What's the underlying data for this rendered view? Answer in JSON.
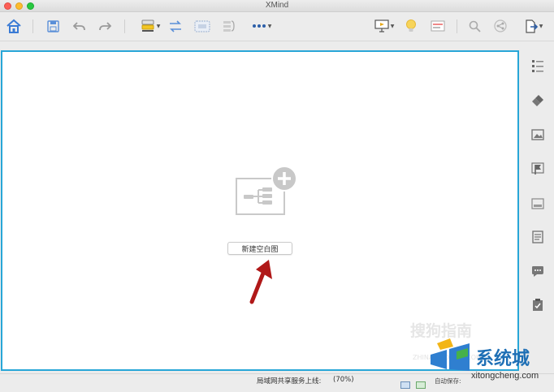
{
  "window": {
    "title": "XMind"
  },
  "toolbar": {
    "icons": [
      "home-icon",
      "save-icon",
      "undo-icon",
      "redo-icon",
      "style-icon",
      "relationship-icon",
      "boundary-icon",
      "summary-icon",
      "more-icon",
      "presentation-icon",
      "idea-icon",
      "outline-icon",
      "search-icon",
      "share-icon",
      "export-icon"
    ]
  },
  "canvas": {
    "new_blank_label": "新建空白图"
  },
  "statusbar": {
    "share_label": "局域网共享服务上线:",
    "zoom": "(70%)",
    "autosave_label": "自动保存:"
  },
  "watermark": {
    "sogou_text": "搜狗指南",
    "sogou_sub": "ZHINAN.SOGOU.COM",
    "site_cn": "系统城",
    "site_url": "xitongcheng.com"
  },
  "colors": {
    "accent": "#28a6d7",
    "arrow": "#b01818",
    "toolbar_blue": "#3a7bd5"
  }
}
